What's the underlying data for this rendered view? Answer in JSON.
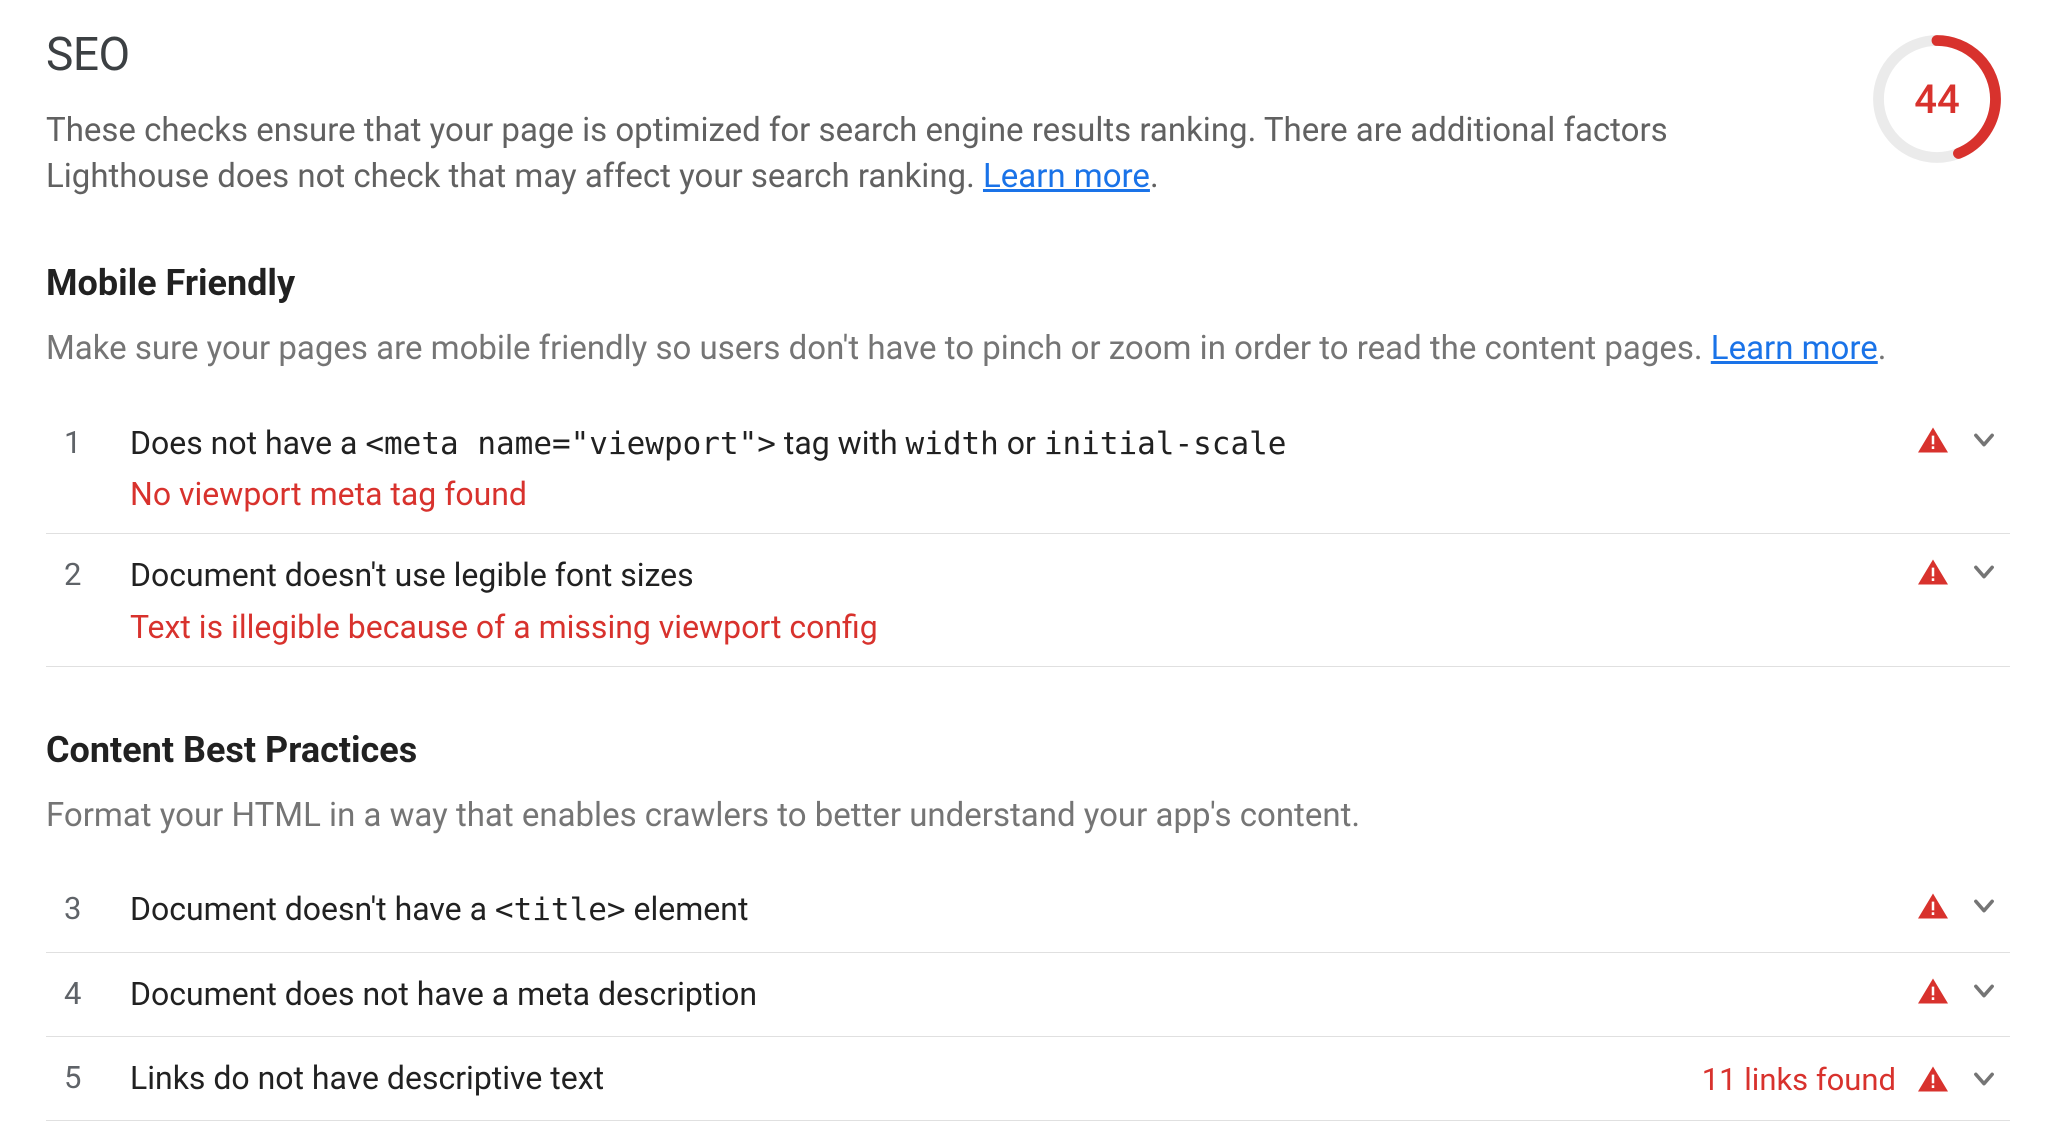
{
  "header": {
    "title": "SEO",
    "description_pre": "These checks ensure that your page is optimized for search engine results ranking. There are additional factors Lighthouse does not check that may affect your search ranking. ",
    "learn_more": "Learn more",
    "description_post": "."
  },
  "score": {
    "value": 44,
    "color": "#d8322d",
    "percent": 44
  },
  "sections": [
    {
      "id": "mobile",
      "title": "Mobile Friendly",
      "description_pre": "Make sure your pages are mobile friendly so users don't have to pinch or zoom in order to read the content pages. ",
      "learn_more": "Learn more",
      "description_post": ".",
      "audits": [
        {
          "num": "1",
          "title_parts": [
            {
              "t": "Does not have a ",
              "code": false
            },
            {
              "t": "<meta name=\"viewport\">",
              "code": true
            },
            {
              "t": " tag with ",
              "code": false
            },
            {
              "t": "width",
              "code": true
            },
            {
              "t": " or ",
              "code": false
            },
            {
              "t": "initial-scale",
              "code": true
            }
          ],
          "message": "No viewport meta tag found",
          "tail_text": "",
          "severity": "warn"
        },
        {
          "num": "2",
          "title_parts": [
            {
              "t": "Document doesn't use legible font sizes",
              "code": false
            }
          ],
          "message": "Text is illegible because of a missing viewport config",
          "tail_text": "",
          "severity": "warn"
        }
      ]
    },
    {
      "id": "content",
      "title": "Content Best Practices",
      "description_pre": "Format your HTML in a way that enables crawlers to better understand your app's content.",
      "learn_more": "",
      "description_post": "",
      "audits": [
        {
          "num": "3",
          "title_parts": [
            {
              "t": "Document doesn't have a ",
              "code": false
            },
            {
              "t": "<title>",
              "code": true
            },
            {
              "t": " element",
              "code": false
            }
          ],
          "message": "",
          "tail_text": "",
          "severity": "warn"
        },
        {
          "num": "4",
          "title_parts": [
            {
              "t": "Document does not have a meta description",
              "code": false
            }
          ],
          "message": "",
          "tail_text": "",
          "severity": "warn"
        },
        {
          "num": "5",
          "title_parts": [
            {
              "t": "Links do not have descriptive text",
              "code": false
            }
          ],
          "message": "",
          "tail_text": "11 links found",
          "severity": "warn"
        }
      ]
    }
  ]
}
